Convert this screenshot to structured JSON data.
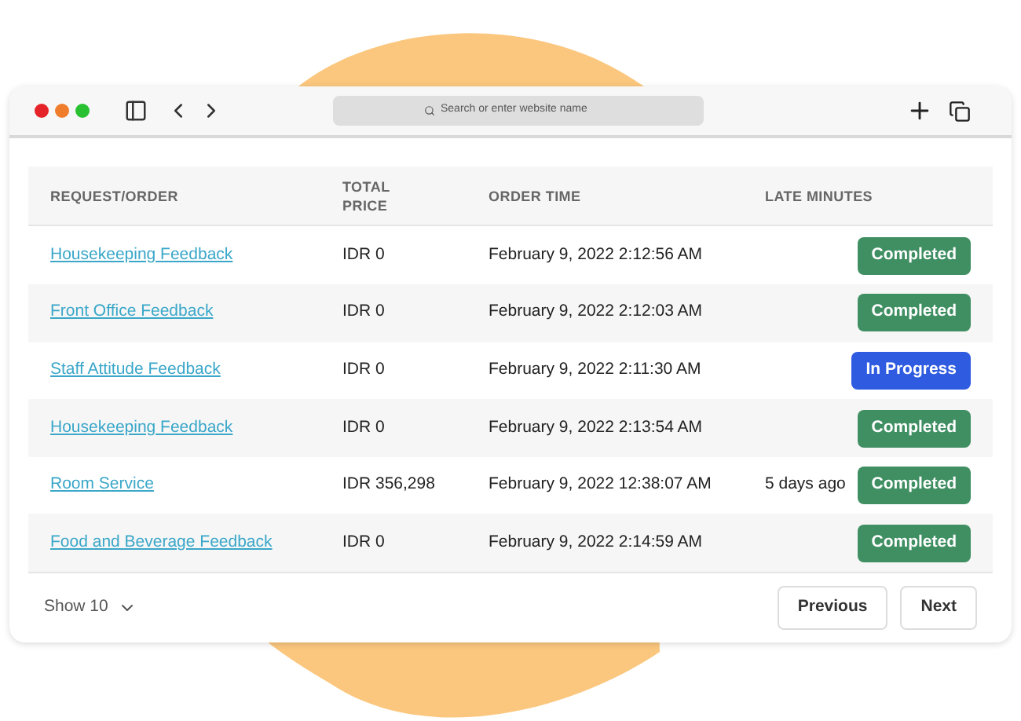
{
  "browser": {
    "address_placeholder": "Search or enter website name"
  },
  "table": {
    "columns": [
      "REQUEST/ORDER",
      "TOTAL\nPRICE",
      "ORDER TIME",
      "LATE MINUTES"
    ],
    "rows": [
      {
        "request": "Housekeeping Feedback",
        "price": "IDR 0",
        "time": "February 9, 2022 2:12:56 AM",
        "late": "",
        "status": "Completed",
        "kind": "completed"
      },
      {
        "request": "Front Office Feedback",
        "price": "IDR 0",
        "time": "February 9, 2022 2:12:03 AM",
        "late": "",
        "status": "Completed",
        "kind": "completed"
      },
      {
        "request": "Staff Attitude Feedback",
        "price": "IDR 0",
        "time": "February 9, 2022 2:11:30 AM",
        "late": "",
        "status": "In Progress",
        "kind": "in_progress"
      },
      {
        "request": "Housekeeping Feedback",
        "price": "IDR 0",
        "time": "February 9, 2022 2:13:54 AM",
        "late": "",
        "status": "Completed",
        "kind": "completed"
      },
      {
        "request": "Room Service",
        "price": "IDR 356,298",
        "time": "February 9, 2022 12:38:07 AM",
        "late": "5 days ago",
        "status": "Completed",
        "kind": "completed"
      },
      {
        "request": "Food and Beverage Feedback",
        "price": "IDR 0",
        "time": "February 9, 2022 2:14:59 AM",
        "late": "",
        "status": "Completed",
        "kind": "completed"
      }
    ]
  },
  "footer": {
    "page_size": "Show 10",
    "buttons": [
      "Previous",
      "Next"
    ]
  }
}
